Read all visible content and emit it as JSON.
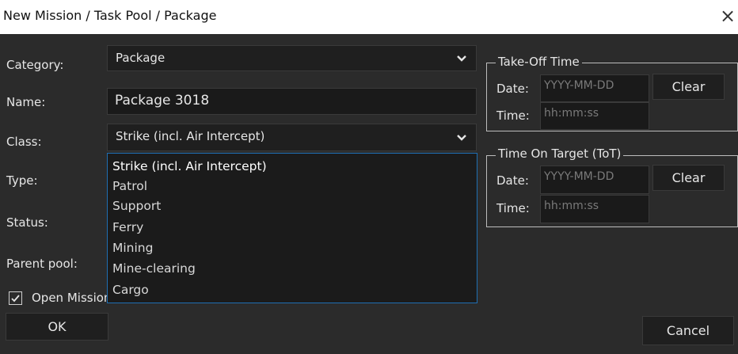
{
  "window": {
    "title": "New Mission / Task Pool / Package",
    "close_icon": "×"
  },
  "form": {
    "category_label": "Category:",
    "category_value": "Package",
    "name_label": "Name:",
    "name_value": "Package 3018",
    "class_label": "Class:",
    "class_value": "Strike (incl. Air Intercept)",
    "type_label": "Type:",
    "status_label": "Status:",
    "parent_pool_label": "Parent pool:",
    "class_options": [
      "Strike (incl. Air Intercept)",
      "Patrol",
      "Support",
      "Ferry",
      "Mining",
      "Mine-clearing",
      "Cargo"
    ],
    "open_editor_label": "Open Mission Editor window",
    "open_editor_checked": true
  },
  "takeoff": {
    "title": "Take-Off Time",
    "date_label": "Date:",
    "date_placeholder": "YYYY-MM-DD",
    "time_label": "Time:",
    "time_placeholder": "hh:mm:ss",
    "clear_label": "Clear"
  },
  "tot": {
    "title": "Time On Target (ToT)",
    "date_label": "Date:",
    "date_placeholder": "YYYY-MM-DD",
    "time_label": "Time:",
    "time_placeholder": "hh:mm:ss",
    "clear_label": "Clear"
  },
  "buttons": {
    "ok_label": "OK",
    "cancel_label": "Cancel"
  },
  "colors": {
    "background": "#2b2b2b",
    "field": "#1a1a1a",
    "dropdown_border": "#1f6fb3",
    "titlebar": "#ffffff"
  }
}
